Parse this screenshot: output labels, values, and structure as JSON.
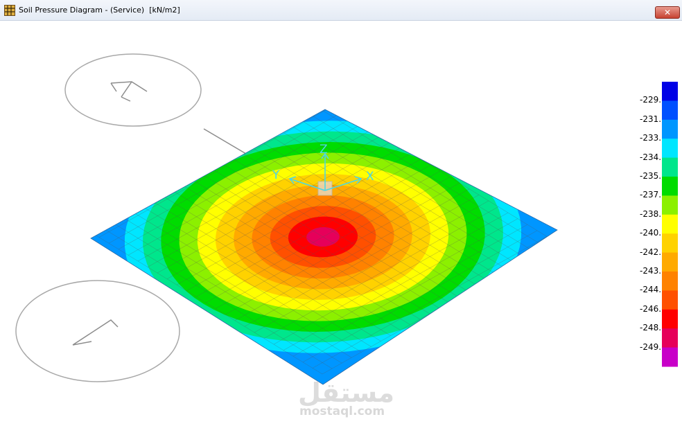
{
  "window": {
    "title": "Soil Pressure Diagram - (Service)  [kN/m2]",
    "close_glyph": "✕",
    "icon": "grid-app-icon"
  },
  "axes": {
    "x": "X",
    "y": "Y",
    "z": "Z"
  },
  "legend": {
    "labels": [
      "-229.",
      "-231.",
      "-233.",
      "-234.",
      "-235.",
      "-237.",
      "-238.",
      "-240.",
      "-242.",
      "-243.",
      "-244.",
      "-246.",
      "-248.",
      "-249."
    ],
    "colors": [
      "#0000e6",
      "#0050ff",
      "#0096ff",
      "#00e6ff",
      "#00e68c",
      "#00dc00",
      "#8cf000",
      "#ffff00",
      "#ffd200",
      "#ffaa00",
      "#ff8200",
      "#ff5000",
      "#ff0000",
      "#e6005a",
      "#c800c8"
    ]
  },
  "contour_colors": [
    "#0096ff",
    "#00e6ff",
    "#00e68c",
    "#00dc00",
    "#8cf000",
    "#ffff00",
    "#ffd200",
    "#ffaa00",
    "#ff8200",
    "#ff5000",
    "#ff0000",
    "#e6005a"
  ],
  "watermark": {
    "arabic": "مستقل",
    "latin": "mostaql.com"
  }
}
